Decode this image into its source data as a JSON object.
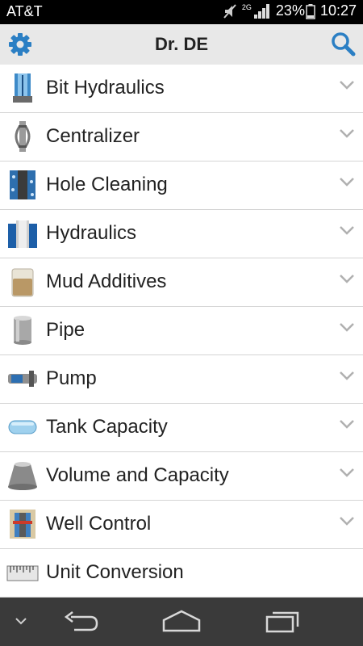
{
  "status": {
    "carrier": "AT&T",
    "network": "2G",
    "battery": "23%",
    "time": "10:27"
  },
  "appbar": {
    "title": "Dr. DE",
    "left_icon": "gear-icon",
    "right_icon": "search-icon"
  },
  "menu": {
    "items": [
      {
        "label": "Bit Hydraulics",
        "icon": "bit-hydraulics-icon"
      },
      {
        "label": "Centralizer",
        "icon": "centralizer-icon"
      },
      {
        "label": "Hole Cleaning",
        "icon": "hole-cleaning-icon"
      },
      {
        "label": "Hydraulics",
        "icon": "hydraulics-icon"
      },
      {
        "label": "Mud Additives",
        "icon": "mud-additives-icon"
      },
      {
        "label": "Pipe",
        "icon": "pipe-icon"
      },
      {
        "label": "Pump",
        "icon": "pump-icon"
      },
      {
        "label": "Tank Capacity",
        "icon": "tank-capacity-icon"
      },
      {
        "label": "Volume and Capacity",
        "icon": "volume-capacity-icon"
      },
      {
        "label": "Well Control",
        "icon": "well-control-icon"
      },
      {
        "label": "Unit Conversion",
        "icon": "unit-conversion-icon"
      }
    ]
  },
  "colors": {
    "accent": "#2b7fc4",
    "appbar_bg": "#e8e8e8",
    "navbar_bg": "#3a3a3a"
  }
}
